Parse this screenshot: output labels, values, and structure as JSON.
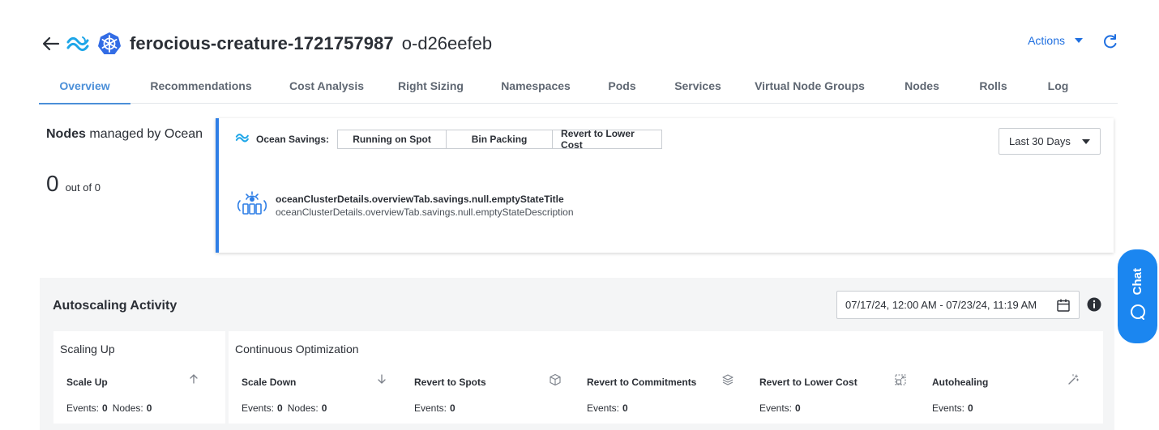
{
  "header": {
    "cluster_name": "ferocious-creature-1721757987",
    "cluster_id": "o-d26eefeb",
    "actions_label": "Actions"
  },
  "tabs": [
    {
      "label": "Overview",
      "active": true
    },
    {
      "label": "Recommendations"
    },
    {
      "label": "Cost Analysis"
    },
    {
      "label": "Right Sizing"
    },
    {
      "label": "Namespaces"
    },
    {
      "label": "Pods"
    },
    {
      "label": "Services"
    },
    {
      "label": "Virtual Node Groups"
    },
    {
      "label": "Nodes"
    },
    {
      "label": "Rolls"
    },
    {
      "label": "Log"
    }
  ],
  "nodes_panel": {
    "title_bold": "Nodes",
    "title_rest": "managed by Ocean",
    "count": "0",
    "out_of": "out of 0"
  },
  "savings": {
    "label": "Ocean Savings:",
    "segments": [
      "Running on Spot",
      "Bin Packing",
      "Revert to Lower Cost"
    ],
    "range": "Last 30 Days",
    "empty_title": "oceanClusterDetails.overviewTab.savings.null.emptyStateTitle",
    "empty_description": "oceanClusterDetails.overviewTab.savings.null.emptyStateDescription"
  },
  "autoscaling": {
    "title": "Autoscaling Activity",
    "date_range": "07/17/24, 12:00 AM - 07/23/24, 11:19 AM",
    "scaling_up": {
      "title": "Scaling Up",
      "metric": {
        "title": "Scale Up",
        "events_label": "Events:",
        "events": "0",
        "nodes_label": "Nodes:",
        "nodes": "0"
      }
    },
    "continuous": {
      "title": "Continuous Optimization",
      "scale_down": {
        "title": "Scale Down",
        "events_label": "Events:",
        "events": "0",
        "nodes_label": "Nodes:",
        "nodes": "0"
      },
      "revert_spots": {
        "title": "Revert to Spots",
        "events_label": "Events:",
        "events": "0"
      },
      "revert_commitments": {
        "title": "Revert to Commitments",
        "events_label": "Events:",
        "events": "0"
      },
      "revert_lower_cost": {
        "title": "Revert to Lower Cost",
        "events_label": "Events:",
        "events": "0"
      },
      "autohealing": {
        "title": "Autohealing",
        "events_label": "Events:",
        "events": "0"
      }
    }
  },
  "chat": {
    "label": "Chat"
  },
  "colors": {
    "accent": "#1f6fe0",
    "tab_active": "#4b8fd8",
    "chat_bg": "#1b86f0"
  },
  "icons": [
    "back-arrow-icon",
    "ocean-logo-icon",
    "kubernetes-icon",
    "refresh-icon",
    "calendar-icon",
    "info-icon",
    "cube-icon",
    "layers-icon",
    "resize-icon",
    "magic-wand-icon",
    "chat-icon"
  ]
}
